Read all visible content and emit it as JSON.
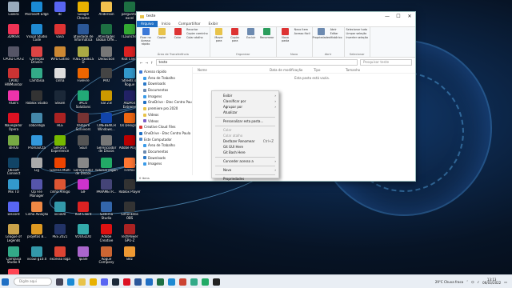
{
  "desktop_icons": [
    {
      "label": "Lixeira",
      "color": "#9ab"
    },
    {
      "label": "Microsoft Edge",
      "color": "#1a8ad4"
    },
    {
      "label": "dc",
      "color": "#5865f2"
    },
    {
      "label": "Google Chrome",
      "color": "#e8b100"
    },
    {
      "label": "Anderson",
      "color": "#f2c14e"
    },
    {
      "label": "perguntas excel",
      "color": "#1d6f42"
    },
    {
      "label": "3DMark",
      "color": "#e35"
    },
    {
      "label": "Visual Studio Code",
      "color": "#1f8ad2"
    },
    {
      "label": "vava",
      "color": "#d33"
    },
    {
      "label": "atividade de Informática",
      "color": "#2b5797"
    },
    {
      "label": "Atividades Global Offe...",
      "color": "#1d6f42"
    },
    {
      "label": "TLauncher",
      "color": "#3a3"
    },
    {
      "label": "CPUID CPU-Z",
      "color": "#556"
    },
    {
      "label": "Correção Drivers",
      "color": "#d44"
    },
    {
      "label": "WYD Latino",
      "color": "#c83"
    },
    {
      "label": "FUEL REBELS D",
      "color": "#aa4"
    },
    {
      "label": "Deduction",
      "color": "#777"
    },
    {
      "label": "Riot Client",
      "color": "#d22"
    },
    {
      "label": "CPUID HWMonitor",
      "color": "#c33"
    },
    {
      "label": "Camtasia",
      "color": "#3a8"
    },
    {
      "label": "cinha",
      "color": "#ddd"
    },
    {
      "label": "FiveFire",
      "color": "#e60"
    },
    {
      "label": "PRO",
      "color": "#444"
    },
    {
      "label": "Streets of Rogue",
      "color": "#39c"
    },
    {
      "label": "RGB's",
      "color": "#e3a"
    },
    {
      "label": "Roblox Studio",
      "color": "#333"
    },
    {
      "label": "Steam",
      "color": "#1b2838"
    },
    {
      "label": "iPICO Solutions",
      "color": "#2a7"
    },
    {
      "label": "kal 2.8",
      "color": "#c90"
    },
    {
      "label": "AIDA64 Extreme",
      "color": "#226"
    },
    {
      "label": "Navegador Opera",
      "color": "#d12"
    },
    {
      "label": "cobcelligo",
      "color": "#48a"
    },
    {
      "label": "HLE",
      "color": "#a22"
    },
    {
      "label": "Vampire Survivors",
      "color": "#733"
    },
    {
      "label": "CINEBENCH Windows...",
      "color": "#14a"
    },
    {
      "label": "Os Design...",
      "color": "#e61"
    },
    {
      "label": "idleOx",
      "color": "#7a4"
    },
    {
      "label": "PromaxCta",
      "color": "#39d"
    },
    {
      "label": "GeForce Experience",
      "color": "#76b900"
    },
    {
      "label": "Skull",
      "color": "#555"
    },
    {
      "label": "Gerenciador de Discos",
      "color": "#777"
    },
    {
      "label": "Adobe Player",
      "color": "#b00"
    },
    {
      "label": "Ubisoft Connect",
      "color": "#146"
    },
    {
      "label": "Lig",
      "color": "#aaa"
    },
    {
      "label": "Garena Multi",
      "color": "#e40"
    },
    {
      "label": "Gerenciador de Discos",
      "color": "#888"
    },
    {
      "label": "tutorial organ",
      "color": "#2a6"
    },
    {
      "label": "Firefox",
      "color": "#f73"
    },
    {
      "label": "Mix TO",
      "color": "#39c"
    },
    {
      "label": "Op File Manager",
      "color": "#55a"
    },
    {
      "label": "cinha Amigo",
      "color": "#d53"
    },
    {
      "label": "GIF",
      "color": "#c3c"
    },
    {
      "label": "PARAMETR...",
      "color": "#447"
    },
    {
      "label": "Roblox Player",
      "color": "#333"
    },
    {
      "label": "Discord",
      "color": "#5865f2"
    },
    {
      "label": "Cinha Aviação",
      "color": "#e84"
    },
    {
      "label": "vicio00",
      "color": "#39a"
    },
    {
      "label": "Riot Client",
      "color": "#d22"
    },
    {
      "label": "Sistema Studio",
      "color": "#36a"
    },
    {
      "label": "Simonklibs OBS",
      "color": "#333"
    },
    {
      "label": "League of Legends",
      "color": "#c9a24a"
    },
    {
      "label": "projetos B...",
      "color": "#d92"
    },
    {
      "label": "PES 2021",
      "color": "#236"
    },
    {
      "label": "VOUGLOO",
      "color": "#3aa"
    },
    {
      "label": "Adobe Creative",
      "color": "#d11"
    },
    {
      "label": "TechPower GPU-Z",
      "color": "#a22"
    },
    {
      "label": "Camtasia Studio 9",
      "color": "#3a8"
    },
    {
      "label": "vicoul g10.0",
      "color": "#39a"
    },
    {
      "label": "excesso loga",
      "color": "#d43"
    },
    {
      "label": "Ipiale",
      "color": "#a6c"
    },
    {
      "label": "Rogue Company",
      "color": "#c63"
    },
    {
      "label": "Bitz",
      "color": "#e93"
    },
    {
      "label": "VALORANT",
      "color": "#ff4655"
    }
  ],
  "window": {
    "title": "teste",
    "controls": {
      "minimize": "—",
      "maximize": "☐",
      "close": "✕"
    },
    "tabs": [
      "Arquivo",
      "Início",
      "Compartilhar",
      "Exibir"
    ],
    "ribbon": {
      "groups": [
        {
          "caption": "Área de Transferência",
          "buttons": [
            "Fixar no Acesso rápido",
            "Copiar",
            "Colar"
          ],
          "list": [
            "Recortar",
            "Copiar caminho",
            "Colar atalho"
          ]
        },
        {
          "caption": "Organizar",
          "buttons": [
            "Mover para",
            "Copiar para",
            "Excluir",
            "Renomear"
          ],
          "list": []
        },
        {
          "caption": "Novo",
          "buttons": [
            "Nova pasta"
          ],
          "list": [
            "Novo item",
            "Acesso fácil"
          ]
        },
        {
          "caption": "Abrir",
          "buttons": [
            "Propriedades"
          ],
          "list": [
            "Abrir",
            "Editar",
            "Histórico"
          ]
        },
        {
          "caption": "Selecionar",
          "buttons": [],
          "list": [
            "Selecionar tudo",
            "Limpar seleção",
            "Inverter seleção"
          ]
        }
      ]
    },
    "address": {
      "path": "teste",
      "search_placeholder": "Pesquisar teste"
    },
    "nav_items": [
      {
        "label": "Acesso rápido",
        "color": "#3b78d8"
      },
      {
        "label": "Área de Trabalho",
        "color": "#3b9be8"
      },
      {
        "label": "Downloads",
        "color": "#2a78c8"
      },
      {
        "label": "Documentos",
        "color": "#6c8ab0"
      },
      {
        "label": "Imagens",
        "color": "#3b9be8"
      },
      {
        "label": "OneDrive - Etec Centro Paul",
        "color": "#1f6fc4"
      },
      {
        "label": "premiere pro 2020",
        "color": "#e8c34a"
      },
      {
        "label": "Vídeos",
        "color": "#e8c34a"
      },
      {
        "label": "Vídeos",
        "color": "#7a5ec8"
      },
      {
        "label": "Creative Cloud Files",
        "color": "#d33"
      },
      {
        "label": "OneDrive - Etec Centro Paula",
        "color": "#1f6fc4"
      },
      {
        "label": "Este Computador",
        "color": "#4a8ad0"
      },
      {
        "label": "Área de Trabalho",
        "color": "#3b9be8"
      },
      {
        "label": "Documentos",
        "color": "#6c8ab0"
      },
      {
        "label": "Downloads",
        "color": "#2a78c8"
      },
      {
        "label": "Imagens",
        "color": "#3b9be8"
      }
    ],
    "columns": [
      "Nome",
      "Data de modificação",
      "Tipo",
      "Tamanho"
    ],
    "empty_message": "Esta pasta está vazia.",
    "status": "0 itens"
  },
  "context_menu": {
    "items": [
      {
        "label": "Exibir",
        "arrow": "›",
        "shortcut": "",
        "disabled": false
      },
      {
        "label": "Classificar por",
        "arrow": "›",
        "shortcut": "",
        "disabled": false
      },
      {
        "label": "Agrupar por",
        "arrow": "›",
        "shortcut": "",
        "disabled": false
      },
      {
        "label": "Atualizar",
        "arrow": "",
        "shortcut": "",
        "disabled": false
      },
      {
        "sep": true
      },
      {
        "label": "Personalizar esta pasta...",
        "arrow": "",
        "shortcut": "",
        "disabled": false
      },
      {
        "sep": true
      },
      {
        "label": "Colar",
        "arrow": "",
        "shortcut": "",
        "disabled": true
      },
      {
        "label": "Colar atalho",
        "arrow": "",
        "shortcut": "",
        "disabled": true
      },
      {
        "label": "Desfazer Renomear",
        "arrow": "",
        "shortcut": "Ctrl+Z",
        "disabled": false
      },
      {
        "label": "Git GUI Here",
        "arrow": "",
        "shortcut": "",
        "disabled": false
      },
      {
        "label": "Git Bash Here",
        "arrow": "",
        "shortcut": "",
        "disabled": false
      },
      {
        "sep": true
      },
      {
        "label": "Conceder acesso a",
        "arrow": "›",
        "shortcut": "",
        "disabled": false
      },
      {
        "sep": true
      },
      {
        "label": "Novo",
        "arrow": "›",
        "shortcut": "",
        "disabled": false
      },
      {
        "sep": true
      },
      {
        "label": "Propriedades",
        "arrow": "",
        "shortcut": "",
        "disabled": false
      }
    ]
  },
  "taskbar": {
    "search_placeholder": "Digite aqui",
    "apps": [
      {
        "name": "task-view",
        "color": "#445"
      },
      {
        "name": "edge",
        "color": "#1a8ad4"
      },
      {
        "name": "explorer",
        "color": "#e8c34a"
      },
      {
        "name": "chrome",
        "color": "#e8b100"
      },
      {
        "name": "discord",
        "color": "#5865f2"
      },
      {
        "name": "steam",
        "color": "#1b2838"
      },
      {
        "name": "opera",
        "color": "#d12"
      },
      {
        "name": "word",
        "color": "#2b579a"
      },
      {
        "name": "mail",
        "color": "#1f6fc4"
      },
      {
        "name": "excel",
        "color": "#1d6f42"
      },
      {
        "name": "vscode",
        "color": "#1f8ad2"
      },
      {
        "name": "media",
        "color": "#c43"
      },
      {
        "name": "photos",
        "color": "#3a8"
      },
      {
        "name": "store",
        "color": "#2a6"
      },
      {
        "name": "terminal",
        "color": "#222"
      }
    ],
    "weather": "29°C  Chuva fraca",
    "time": "13:13",
    "date": "06/03/2022"
  }
}
